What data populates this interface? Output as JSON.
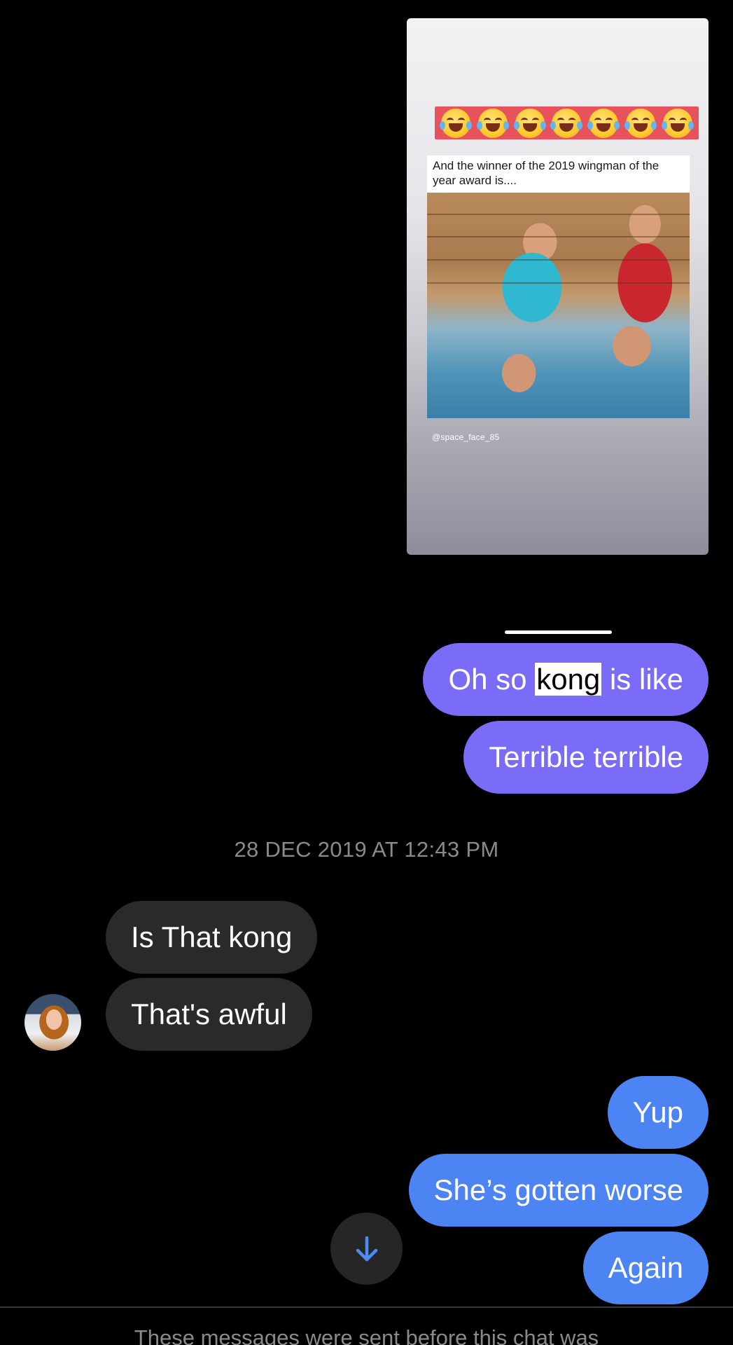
{
  "story": {
    "emojis": [
      "😂",
      "😂",
      "😂",
      "😂",
      "😂",
      "😂",
      "😂"
    ],
    "caption": "And the winner of the 2019 wingman of the year award is....",
    "credit": "@space_face_85"
  },
  "messages_before": [
    {
      "pre": "Oh so ",
      "highlight": "kong",
      "post": " is like"
    },
    {
      "text": "Terrible terrible"
    }
  ],
  "timestamp": "28 DEC 2019 AT 12:43 PM",
  "received": [
    {
      "text": "Is That kong"
    },
    {
      "text": "That's awful"
    }
  ],
  "sent_after": [
    {
      "text": "Yup"
    },
    {
      "text": "She’s gotten worse"
    },
    {
      "text": "Again"
    }
  ],
  "footer": "These messages were sent before this chat was",
  "colors": {
    "purple_bubble": "#7a6cf7",
    "blue_bubble": "#4d84f4",
    "grey_bubble": "#2a2a2a",
    "scroll_arrow": "#4d8cf5"
  },
  "icons": {
    "scroll_down": "arrow-down-icon"
  }
}
